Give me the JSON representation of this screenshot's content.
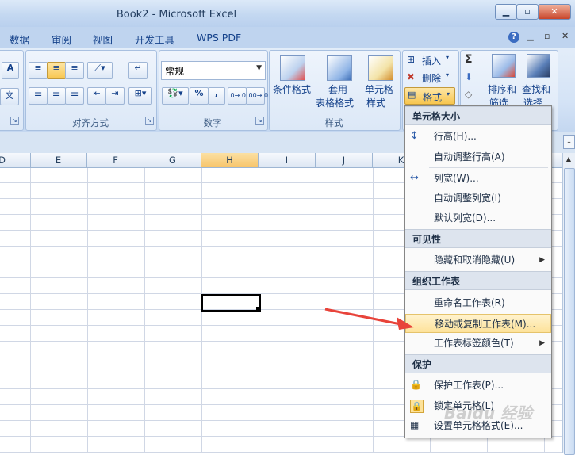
{
  "window": {
    "title": "Book2 - Microsoft Excel",
    "minimize": "▁",
    "restore": "▫",
    "close": "✕"
  },
  "tabs": [
    "数据",
    "审阅",
    "视图",
    "开发工具",
    "WPS PDF"
  ],
  "help": "?",
  "ribbon": {
    "alignment_group": "对齐方式",
    "number_group": "数字",
    "styles_group": "样式",
    "number_format": "常规",
    "percent": "%",
    "comma": ",",
    "font_partial_a": "A",
    "font_partial_b": "文",
    "conditional_format": "条件格式",
    "table_format_1": "套用",
    "table_format_2": "表格格式",
    "cell_style_1": "单元格",
    "cell_style_2": "样式",
    "insert": "插入",
    "delete": "删除",
    "format": "格式",
    "sort_filter_1": "排序和",
    "sort_filter_2": "筛选",
    "find_select_1": "查找和",
    "find_select_2": "选择",
    "sigma": "Σ"
  },
  "columns": [
    "D",
    "E",
    "F",
    "G",
    "H",
    "I",
    "J",
    "K"
  ],
  "selected_column": "H",
  "menu": {
    "sections": [
      {
        "header": "单元格大小",
        "items": [
          {
            "label": "行高(H)...",
            "icon": "row-height-icon"
          },
          {
            "label": "自动调整行高(A)"
          },
          {
            "label": "列宽(W)...",
            "icon": "column-width-icon"
          },
          {
            "label": "自动调整列宽(I)"
          },
          {
            "label": "默认列宽(D)..."
          }
        ]
      },
      {
        "header": "可见性",
        "items": [
          {
            "label": "隐藏和取消隐藏(U)",
            "submenu": true
          }
        ]
      },
      {
        "header": "组织工作表",
        "items": [
          {
            "label": "重命名工作表(R)"
          },
          {
            "label": "移动或复制工作表(M)...",
            "highlighted": true
          },
          {
            "label": "工作表标签颜色(T)",
            "submenu": true
          }
        ]
      },
      {
        "header": "保护",
        "items": [
          {
            "label": "保护工作表(P)...",
            "icon": "protect-sheet-icon"
          },
          {
            "label": "锁定单元格(L)",
            "icon": "lock-cell-icon"
          },
          {
            "label": "设置单元格格式(E)...",
            "icon": "format-cells-icon"
          }
        ]
      }
    ]
  },
  "watermark": "Baidu 经验",
  "colors": {
    "accent": "#f7c56b",
    "highlight": "#fde29a",
    "arrow": "#e8433a"
  }
}
